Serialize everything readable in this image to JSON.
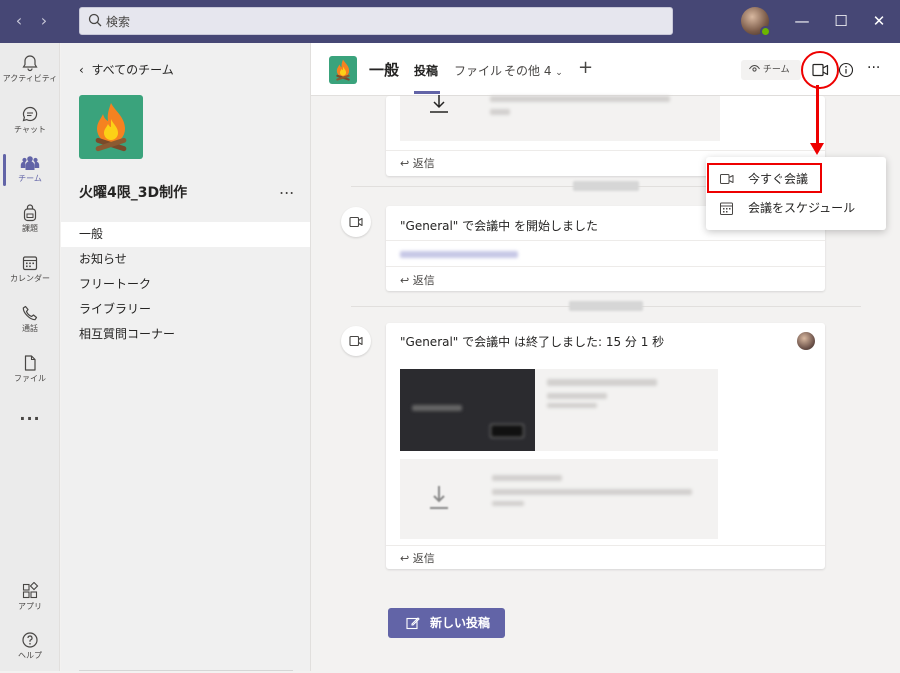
{
  "titlebar": {
    "back_icon": "chevron-left-icon",
    "forward_icon": "chevron-right-icon",
    "search_placeholder": "検索",
    "window_controls": [
      "minimize-icon",
      "maximize-icon",
      "close-icon"
    ]
  },
  "rail": {
    "items": [
      {
        "label": "アクティビティ",
        "icon": "bell-icon"
      },
      {
        "label": "チャット",
        "icon": "chat-icon"
      },
      {
        "label": "チーム",
        "icon": "teams-icon"
      },
      {
        "label": "課題",
        "icon": "backpack-icon"
      },
      {
        "label": "カレンダー",
        "icon": "calendar-icon"
      },
      {
        "label": "通話",
        "icon": "phone-icon"
      },
      {
        "label": "ファイル",
        "icon": "file-icon"
      }
    ],
    "more": "...",
    "bottom": [
      {
        "label": "アプリ",
        "icon": "apps-icon"
      },
      {
        "label": "ヘルプ",
        "icon": "help-icon"
      }
    ]
  },
  "sidebar": {
    "back_label": "すべてのチーム",
    "team_name": "火曜4限_3D制作",
    "more": "...",
    "channels": [
      "一般",
      "お知らせ",
      "フリートーク",
      "ライブラリー",
      "相互質問コーナー"
    ]
  },
  "header": {
    "channel_name": "一般",
    "tabs": [
      "投稿",
      "ファイル",
      "その他 4"
    ],
    "add_tab": "+",
    "team_pill": "チーム",
    "more": "···"
  },
  "messages": [
    {
      "reply": "返信"
    },
    {
      "title": "\"General\" で会議中 を開始しました",
      "reply": "返信"
    },
    {
      "title": "\"General\" で会議中 は終了しました: 15 分 1 秒",
      "reply": "返信"
    }
  ],
  "new_post_label": "新しい投稿",
  "meet_menu": {
    "items": [
      {
        "label": "今すぐ会議",
        "icon": "video-icon"
      },
      {
        "label": "会議をスケジュール",
        "icon": "calendar-icon"
      }
    ]
  },
  "colors": {
    "titlebar": "#464775",
    "accent": "#6264a7",
    "annotation": "#e00000",
    "team_logo": "#3aa37c"
  }
}
